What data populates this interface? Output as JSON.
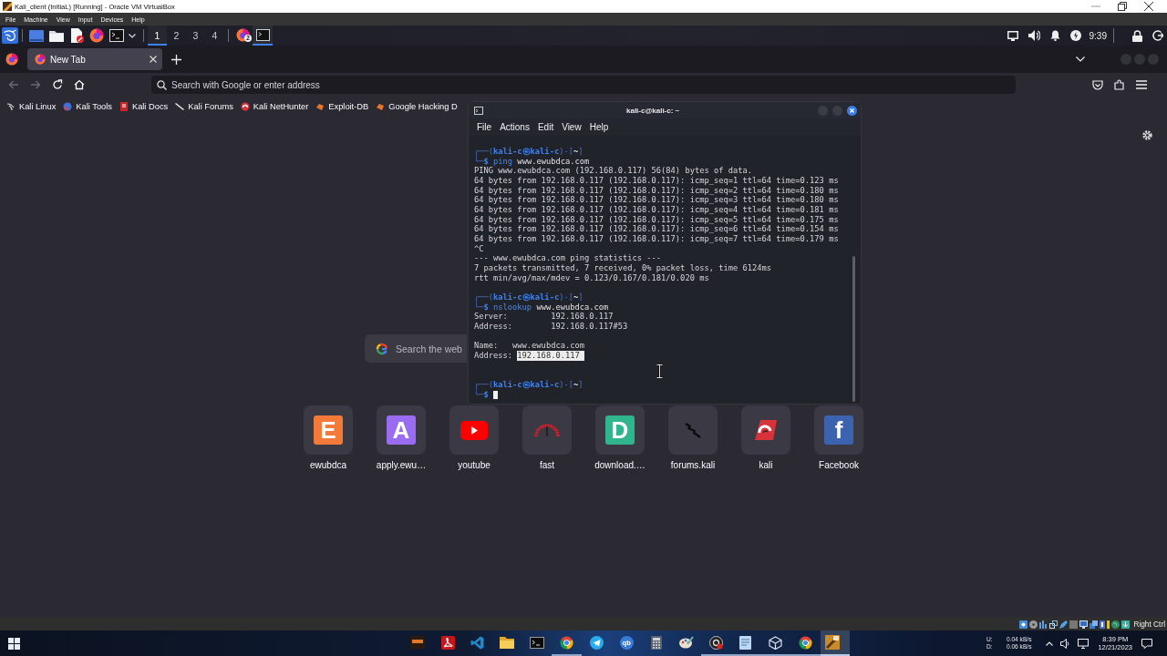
{
  "vbox_window": {
    "title": "Kali_client (InitiaL) [Running] - Oracle VM VirtualBox",
    "menu": [
      "File",
      "Machine",
      "View",
      "Input",
      "Devices",
      "Help"
    ]
  },
  "kali_panel": {
    "workspaces": [
      {
        "label": "1",
        "selected": true
      },
      {
        "label": "2",
        "selected": false
      },
      {
        "label": "3",
        "selected": false
      },
      {
        "label": "4",
        "selected": false
      }
    ],
    "tasks": [
      {
        "kind": "firefox",
        "badge": "2",
        "selected": false
      },
      {
        "kind": "terminal",
        "selected": true
      }
    ],
    "clock": "9:39"
  },
  "browser": {
    "tabs": [
      {
        "label": "New Tab",
        "selected": true
      }
    ],
    "nav_buttons": [
      {
        "kind": "back",
        "disabled": true
      },
      {
        "kind": "forward",
        "disabled": true
      },
      {
        "kind": "reload",
        "disabled": false
      },
      {
        "kind": "home",
        "disabled": false
      }
    ],
    "address_bar": {
      "placeholder": "Search with Google or enter address"
    },
    "bookmarks": [
      {
        "label": "Kali Linux",
        "kind": "dragon"
      },
      {
        "label": "Kali Tools",
        "kind": "tools"
      },
      {
        "label": "Kali Docs",
        "kind": "docs"
      },
      {
        "label": "Kali Forums",
        "kind": "forums"
      },
      {
        "label": "Kali NetHunter",
        "kind": "nethunter"
      },
      {
        "label": "Exploit-DB",
        "kind": "exploit"
      },
      {
        "label": "Google Hacking D",
        "kind": "exploit"
      }
    ],
    "web_search": {
      "placeholder": "Search the web"
    },
    "shortcuts": [
      {
        "label": "ewubdca",
        "kind": "letter",
        "logo_letter": "E",
        "color": "#f47a3a"
      },
      {
        "label": "apply.ewu…",
        "kind": "letter",
        "logo_letter": "A",
        "color": "#9a6cf2"
      },
      {
        "label": "youtube",
        "kind": "youtube"
      },
      {
        "label": "fast",
        "kind": "gauge"
      },
      {
        "label": "download.…",
        "kind": "letter",
        "logo_letter": "D",
        "color": "#2fb68e"
      },
      {
        "label": "forums.kali",
        "kind": "dragon"
      },
      {
        "label": "kali",
        "kind": "nethunter"
      },
      {
        "label": "Facebook",
        "kind": "letter",
        "logo_letter": "f",
        "color": "#3b63b0"
      }
    ]
  },
  "terminal": {
    "title": "kali-c@kali-c: ~",
    "menu": [
      "File",
      "Actions",
      "Edit",
      "View",
      "Help"
    ],
    "lines": [
      {
        "kind": "prompt",
        "segments": [
          {
            "text": "┌──(",
            "kind": "frame"
          },
          {
            "text": "kali-c㉿kali-c",
            "kind": "user"
          },
          {
            "text": ")-[",
            "kind": "frame"
          },
          {
            "text": "~",
            "kind": "path"
          },
          {
            "text": "]",
            "kind": "frame"
          }
        ]
      },
      {
        "kind": "command",
        "segments": [
          {
            "text": "└─",
            "kind": "frame"
          },
          {
            "text": "$ ",
            "kind": "user"
          },
          {
            "text": "ping",
            "kind": "cmd"
          },
          {
            "text": " www.ewubdca.com",
            "kind": "arg"
          }
        ],
        "cursor": false
      },
      {
        "kind": "output",
        "text": "PING www.ewubdca.com (192.168.0.117) 56(84) bytes of data."
      },
      {
        "kind": "output",
        "text": "64 bytes from 192.168.0.117 (192.168.0.117): icmp_seq=1 ttl=64 time=0.123 ms"
      },
      {
        "kind": "output",
        "text": "64 bytes from 192.168.0.117 (192.168.0.117): icmp_seq=2 ttl=64 time=0.180 ms"
      },
      {
        "kind": "output",
        "text": "64 bytes from 192.168.0.117 (192.168.0.117): icmp_seq=3 ttl=64 time=0.180 ms"
      },
      {
        "kind": "output",
        "text": "64 bytes from 192.168.0.117 (192.168.0.117): icmp_seq=4 ttl=64 time=0.181 ms"
      },
      {
        "kind": "output",
        "text": "64 bytes from 192.168.0.117 (192.168.0.117): icmp_seq=5 ttl=64 time=0.175 ms"
      },
      {
        "kind": "output",
        "text": "64 bytes from 192.168.0.117 (192.168.0.117): icmp_seq=6 ttl=64 time=0.154 ms"
      },
      {
        "kind": "output",
        "text": "64 bytes from 192.168.0.117 (192.168.0.117): icmp_seq=7 ttl=64 time=0.179 ms"
      },
      {
        "kind": "output",
        "text": "^C"
      },
      {
        "kind": "output",
        "text": "--- www.ewubdca.com ping statistics ---"
      },
      {
        "kind": "output",
        "text": "7 packets transmitted, 7 received, 0% packet loss, time 6124ms"
      },
      {
        "kind": "output",
        "text": "rtt min/avg/max/mdev = 0.123/0.167/0.181/0.020 ms"
      },
      {
        "kind": "blank"
      },
      {
        "kind": "prompt",
        "segments": [
          {
            "text": "┌──(",
            "kind": "frame"
          },
          {
            "text": "kali-c㉿kali-c",
            "kind": "user"
          },
          {
            "text": ")-[",
            "kind": "frame"
          },
          {
            "text": "~",
            "kind": "path"
          },
          {
            "text": "]",
            "kind": "frame"
          }
        ]
      },
      {
        "kind": "command",
        "segments": [
          {
            "text": "└─",
            "kind": "frame"
          },
          {
            "text": "$ ",
            "kind": "user"
          },
          {
            "text": "nslookup",
            "kind": "cmd"
          },
          {
            "text": " www.ewubdca.com",
            "kind": "arg"
          }
        ],
        "cursor": false
      },
      {
        "kind": "output",
        "text": "Server:         192.168.0.117"
      },
      {
        "kind": "output",
        "text": "Address:        192.168.0.117#53"
      },
      {
        "kind": "blank"
      },
      {
        "kind": "output",
        "text": "Name:   www.ewubdca.com"
      },
      {
        "kind": "output",
        "segments": [
          {
            "text": "Address: ",
            "selected": false
          },
          {
            "text": "192.168.0.117",
            "selected": true
          }
        ]
      },
      {
        "kind": "blank"
      },
      {
        "kind": "blank"
      },
      {
        "kind": "prompt",
        "segments": [
          {
            "text": "┌──(",
            "kind": "frame"
          },
          {
            "text": "kali-c㉿kali-c",
            "kind": "user"
          },
          {
            "text": ")-[",
            "kind": "frame"
          },
          {
            "text": "~",
            "kind": "path"
          },
          {
            "text": "]",
            "kind": "frame"
          }
        ]
      },
      {
        "kind": "command",
        "segments": [
          {
            "text": "└─",
            "kind": "frame"
          },
          {
            "text": "$ ",
            "kind": "user"
          }
        ],
        "cursor": true
      }
    ]
  },
  "vbox_status": {
    "host_key": "Right Ctrl"
  },
  "taskbar": {
    "apps": [
      {
        "kind": "game",
        "running": false,
        "selected": false
      },
      {
        "kind": "acrobat",
        "running": false,
        "selected": false
      },
      {
        "kind": "vscode",
        "running": false,
        "selected": false
      },
      {
        "kind": "explorer",
        "running": false,
        "selected": false
      },
      {
        "kind": "console",
        "running": false,
        "selected": false
      },
      {
        "kind": "chrome",
        "running": true,
        "selected": false
      },
      {
        "kind": "telegram",
        "running": false,
        "selected": false
      },
      {
        "kind": "qbittorrent",
        "logo_text": "qb",
        "running": false,
        "selected": false
      },
      {
        "kind": "calculator",
        "running": false,
        "selected": false
      },
      {
        "kind": "paint",
        "running": false,
        "selected": false
      },
      {
        "kind": "recorder",
        "running": true,
        "selected": false
      },
      {
        "kind": "notepad",
        "running": true,
        "selected": false
      },
      {
        "kind": "virtualbox",
        "running": true,
        "selected": false
      },
      {
        "kind": "chrome",
        "running": true,
        "selected": false
      },
      {
        "kind": "vm_window",
        "running": true,
        "selected": true
      }
    ],
    "network_speed": {
      "up_label": "U:",
      "up_rate": "0.04 kB/s",
      "down_label": "D:",
      "down_rate": "0.06 kB/s"
    },
    "time": "8:39 PM",
    "date": "12/21/2023"
  }
}
